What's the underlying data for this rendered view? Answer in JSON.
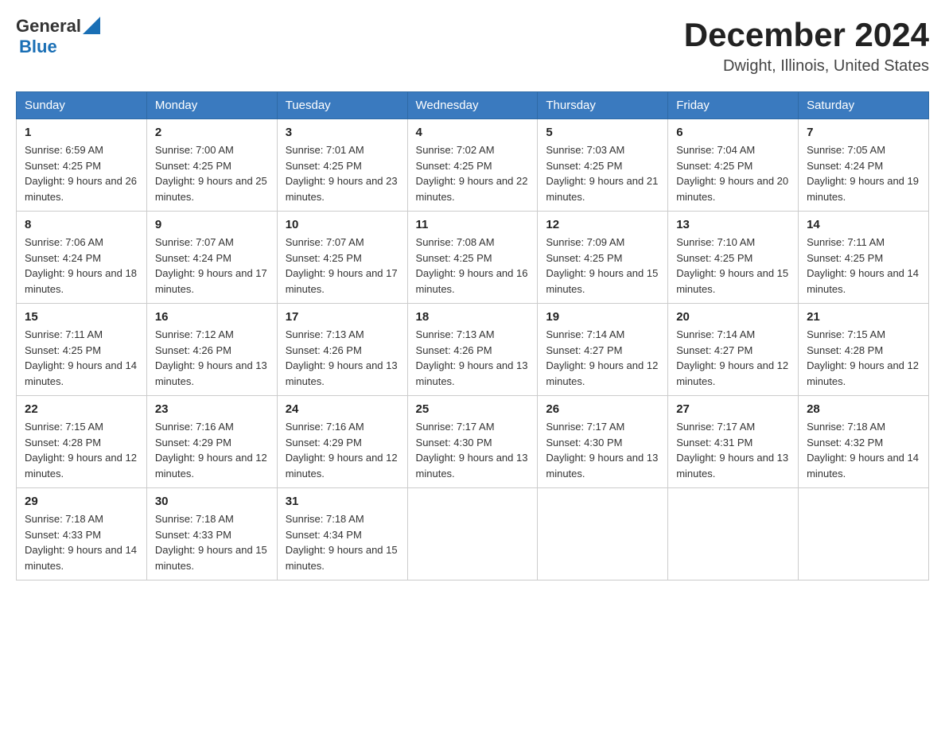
{
  "logo": {
    "text_general": "General",
    "text_blue": "Blue"
  },
  "header": {
    "month_year": "December 2024",
    "location": "Dwight, Illinois, United States"
  },
  "days_of_week": [
    "Sunday",
    "Monday",
    "Tuesday",
    "Wednesday",
    "Thursday",
    "Friday",
    "Saturday"
  ],
  "weeks": [
    [
      {
        "day": "1",
        "sunrise": "Sunrise: 6:59 AM",
        "sunset": "Sunset: 4:25 PM",
        "daylight": "Daylight: 9 hours and 26 minutes."
      },
      {
        "day": "2",
        "sunrise": "Sunrise: 7:00 AM",
        "sunset": "Sunset: 4:25 PM",
        "daylight": "Daylight: 9 hours and 25 minutes."
      },
      {
        "day": "3",
        "sunrise": "Sunrise: 7:01 AM",
        "sunset": "Sunset: 4:25 PM",
        "daylight": "Daylight: 9 hours and 23 minutes."
      },
      {
        "day": "4",
        "sunrise": "Sunrise: 7:02 AM",
        "sunset": "Sunset: 4:25 PM",
        "daylight": "Daylight: 9 hours and 22 minutes."
      },
      {
        "day": "5",
        "sunrise": "Sunrise: 7:03 AM",
        "sunset": "Sunset: 4:25 PM",
        "daylight": "Daylight: 9 hours and 21 minutes."
      },
      {
        "day": "6",
        "sunrise": "Sunrise: 7:04 AM",
        "sunset": "Sunset: 4:25 PM",
        "daylight": "Daylight: 9 hours and 20 minutes."
      },
      {
        "day": "7",
        "sunrise": "Sunrise: 7:05 AM",
        "sunset": "Sunset: 4:24 PM",
        "daylight": "Daylight: 9 hours and 19 minutes."
      }
    ],
    [
      {
        "day": "8",
        "sunrise": "Sunrise: 7:06 AM",
        "sunset": "Sunset: 4:24 PM",
        "daylight": "Daylight: 9 hours and 18 minutes."
      },
      {
        "day": "9",
        "sunrise": "Sunrise: 7:07 AM",
        "sunset": "Sunset: 4:24 PM",
        "daylight": "Daylight: 9 hours and 17 minutes."
      },
      {
        "day": "10",
        "sunrise": "Sunrise: 7:07 AM",
        "sunset": "Sunset: 4:25 PM",
        "daylight": "Daylight: 9 hours and 17 minutes."
      },
      {
        "day": "11",
        "sunrise": "Sunrise: 7:08 AM",
        "sunset": "Sunset: 4:25 PM",
        "daylight": "Daylight: 9 hours and 16 minutes."
      },
      {
        "day": "12",
        "sunrise": "Sunrise: 7:09 AM",
        "sunset": "Sunset: 4:25 PM",
        "daylight": "Daylight: 9 hours and 15 minutes."
      },
      {
        "day": "13",
        "sunrise": "Sunrise: 7:10 AM",
        "sunset": "Sunset: 4:25 PM",
        "daylight": "Daylight: 9 hours and 15 minutes."
      },
      {
        "day": "14",
        "sunrise": "Sunrise: 7:11 AM",
        "sunset": "Sunset: 4:25 PM",
        "daylight": "Daylight: 9 hours and 14 minutes."
      }
    ],
    [
      {
        "day": "15",
        "sunrise": "Sunrise: 7:11 AM",
        "sunset": "Sunset: 4:25 PM",
        "daylight": "Daylight: 9 hours and 14 minutes."
      },
      {
        "day": "16",
        "sunrise": "Sunrise: 7:12 AM",
        "sunset": "Sunset: 4:26 PM",
        "daylight": "Daylight: 9 hours and 13 minutes."
      },
      {
        "day": "17",
        "sunrise": "Sunrise: 7:13 AM",
        "sunset": "Sunset: 4:26 PM",
        "daylight": "Daylight: 9 hours and 13 minutes."
      },
      {
        "day": "18",
        "sunrise": "Sunrise: 7:13 AM",
        "sunset": "Sunset: 4:26 PM",
        "daylight": "Daylight: 9 hours and 13 minutes."
      },
      {
        "day": "19",
        "sunrise": "Sunrise: 7:14 AM",
        "sunset": "Sunset: 4:27 PM",
        "daylight": "Daylight: 9 hours and 12 minutes."
      },
      {
        "day": "20",
        "sunrise": "Sunrise: 7:14 AM",
        "sunset": "Sunset: 4:27 PM",
        "daylight": "Daylight: 9 hours and 12 minutes."
      },
      {
        "day": "21",
        "sunrise": "Sunrise: 7:15 AM",
        "sunset": "Sunset: 4:28 PM",
        "daylight": "Daylight: 9 hours and 12 minutes."
      }
    ],
    [
      {
        "day": "22",
        "sunrise": "Sunrise: 7:15 AM",
        "sunset": "Sunset: 4:28 PM",
        "daylight": "Daylight: 9 hours and 12 minutes."
      },
      {
        "day": "23",
        "sunrise": "Sunrise: 7:16 AM",
        "sunset": "Sunset: 4:29 PM",
        "daylight": "Daylight: 9 hours and 12 minutes."
      },
      {
        "day": "24",
        "sunrise": "Sunrise: 7:16 AM",
        "sunset": "Sunset: 4:29 PM",
        "daylight": "Daylight: 9 hours and 12 minutes."
      },
      {
        "day": "25",
        "sunrise": "Sunrise: 7:17 AM",
        "sunset": "Sunset: 4:30 PM",
        "daylight": "Daylight: 9 hours and 13 minutes."
      },
      {
        "day": "26",
        "sunrise": "Sunrise: 7:17 AM",
        "sunset": "Sunset: 4:30 PM",
        "daylight": "Daylight: 9 hours and 13 minutes."
      },
      {
        "day": "27",
        "sunrise": "Sunrise: 7:17 AM",
        "sunset": "Sunset: 4:31 PM",
        "daylight": "Daylight: 9 hours and 13 minutes."
      },
      {
        "day": "28",
        "sunrise": "Sunrise: 7:18 AM",
        "sunset": "Sunset: 4:32 PM",
        "daylight": "Daylight: 9 hours and 14 minutes."
      }
    ],
    [
      {
        "day": "29",
        "sunrise": "Sunrise: 7:18 AM",
        "sunset": "Sunset: 4:33 PM",
        "daylight": "Daylight: 9 hours and 14 minutes."
      },
      {
        "day": "30",
        "sunrise": "Sunrise: 7:18 AM",
        "sunset": "Sunset: 4:33 PM",
        "daylight": "Daylight: 9 hours and 15 minutes."
      },
      {
        "day": "31",
        "sunrise": "Sunrise: 7:18 AM",
        "sunset": "Sunset: 4:34 PM",
        "daylight": "Daylight: 9 hours and 15 minutes."
      },
      null,
      null,
      null,
      null
    ]
  ]
}
